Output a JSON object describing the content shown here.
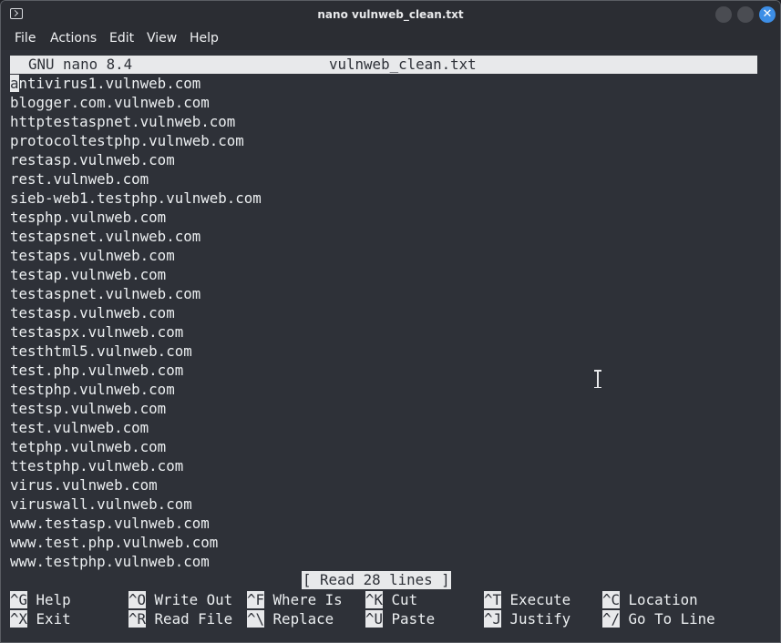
{
  "window": {
    "title": "nano vulnweb_clean.txt",
    "close_glyph": "✕"
  },
  "menu": [
    "File",
    "Actions",
    "Edit",
    "View",
    "Help"
  ],
  "nano": {
    "version": "GNU nano 8.4",
    "filename": "vulnweb_clean.txt",
    "cursor_char": "a",
    "lines": [
      "antivirus1.vulnweb.com",
      "blogger.com.vulnweb.com",
      "httptestaspnet.vulnweb.com",
      "protocoltestphp.vulnweb.com",
      "restasp.vulnweb.com",
      "rest.vulnweb.com",
      "sieb-web1.testphp.vulnweb.com",
      "tesphp.vulnweb.com",
      "testapsnet.vulnweb.com",
      "testaps.vulnweb.com",
      "testap.vulnweb.com",
      "testaspnet.vulnweb.com",
      "testasp.vulnweb.com",
      "testaspx.vulnweb.com",
      "testhtml5.vulnweb.com",
      "test.php.vulnweb.com",
      "testphp.vulnweb.com",
      "testsp.vulnweb.com",
      "test.vulnweb.com",
      "tetphp.vulnweb.com",
      "ttestphp.vulnweb.com",
      "virus.vulnweb.com",
      "viruswall.vulnweb.com",
      "www.testasp.vulnweb.com",
      "www.test.php.vulnweb.com",
      "www.testphp.vulnweb.com"
    ],
    "status": "[ Read 28 lines ]",
    "shortcuts": [
      [
        {
          "key": "^G",
          "label": "Help"
        },
        {
          "key": "^O",
          "label": "Write Out"
        },
        {
          "key": "^F",
          "label": "Where Is"
        },
        {
          "key": "^K",
          "label": "Cut"
        },
        {
          "key": "^T",
          "label": "Execute"
        },
        {
          "key": "^C",
          "label": "Location"
        }
      ],
      [
        {
          "key": "^X",
          "label": "Exit"
        },
        {
          "key": "^R",
          "label": "Read File"
        },
        {
          "key": "^\\",
          "label": "Replace"
        },
        {
          "key": "^U",
          "label": "Paste"
        },
        {
          "key": "^J",
          "label": "Justify"
        },
        {
          "key": "^/",
          "label": "Go To Line"
        }
      ]
    ]
  }
}
